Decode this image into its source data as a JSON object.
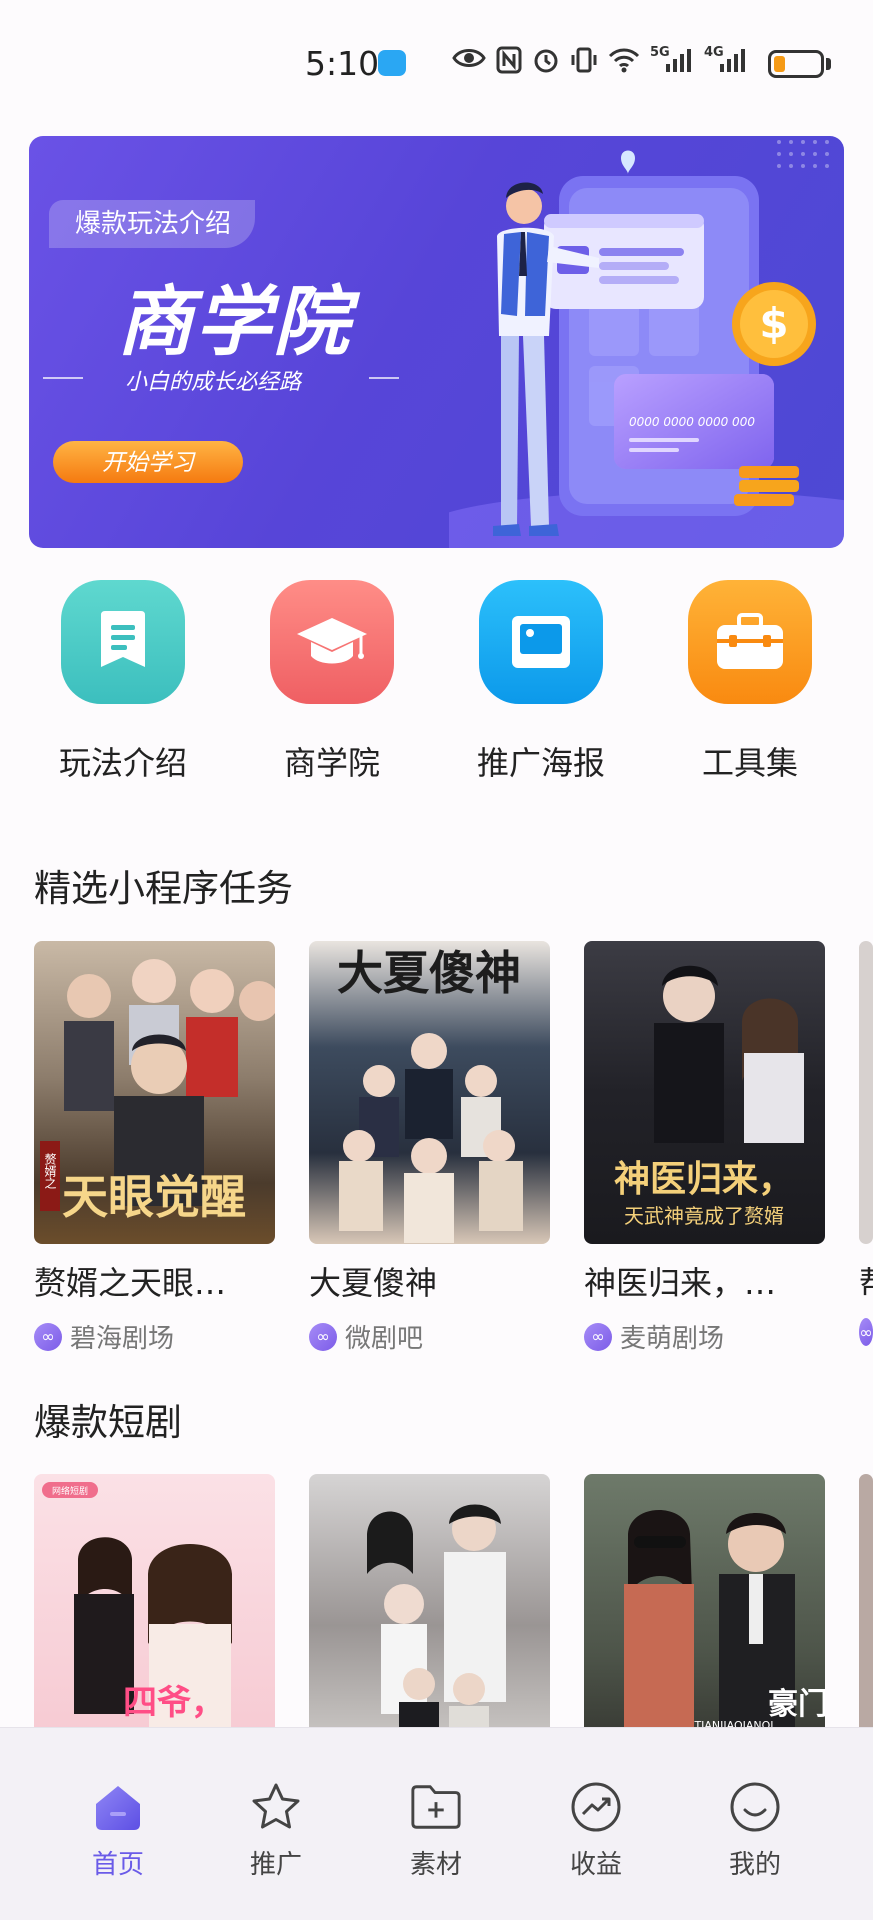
{
  "status_bar": {
    "time": "5:10",
    "network_5g": "5G",
    "network_4g": "4G"
  },
  "banner": {
    "tag": "爆款玩法介绍",
    "title": "商学院",
    "subtitle": "小白的成长必经路",
    "button_label": "开始学习",
    "card_number": "0000 0000 0000 000",
    "coin_symbol": "$"
  },
  "quick_actions": [
    {
      "label": "玩法介绍",
      "icon": "document-icon",
      "color": "#3fc7c2"
    },
    {
      "label": "商学院",
      "icon": "graduation-cap-icon",
      "color": "#f2706f"
    },
    {
      "label": "推广海报",
      "icon": "picture-icon",
      "color": "#16a9f2"
    },
    {
      "label": "工具集",
      "icon": "toolbox-icon",
      "color": "#fb9c17"
    }
  ],
  "featured": {
    "title": "精选小程序任务",
    "items": [
      {
        "title": "赘婿之天眼…",
        "source": "碧海剧场",
        "poster_text": "天眼觉醒",
        "poster_side": "赘婿之"
      },
      {
        "title": "大夏傻神",
        "source": "微剧吧",
        "poster_text": "大夏傻神"
      },
      {
        "title": "神医归来，…",
        "source": "麦萌剧场",
        "poster_text": "神医归来，",
        "poster_sub": "天武神竟成了赘婿"
      },
      {
        "title": "帮",
        "source": ""
      }
    ]
  },
  "hot": {
    "title": "爆款短剧",
    "items": [
      {
        "badge": "网络短剧",
        "poster_text": "四爷，"
      },
      {
        "poster_text": ""
      },
      {
        "poster_text": "豪门",
        "poster_sub": "TIANJIAQIANQI"
      }
    ]
  },
  "bottom_nav": [
    {
      "label": "首页",
      "icon": "home-icon",
      "active": true
    },
    {
      "label": "推广",
      "icon": "star-icon",
      "active": false
    },
    {
      "label": "素材",
      "icon": "folder-add-icon",
      "active": false
    },
    {
      "label": "收益",
      "icon": "trend-icon",
      "active": false
    },
    {
      "label": "我的",
      "icon": "smile-icon",
      "active": false
    }
  ],
  "colors": {
    "accent": "#6a5be8",
    "banner_start": "#6a52e6",
    "button_orange": "#f57a10"
  }
}
